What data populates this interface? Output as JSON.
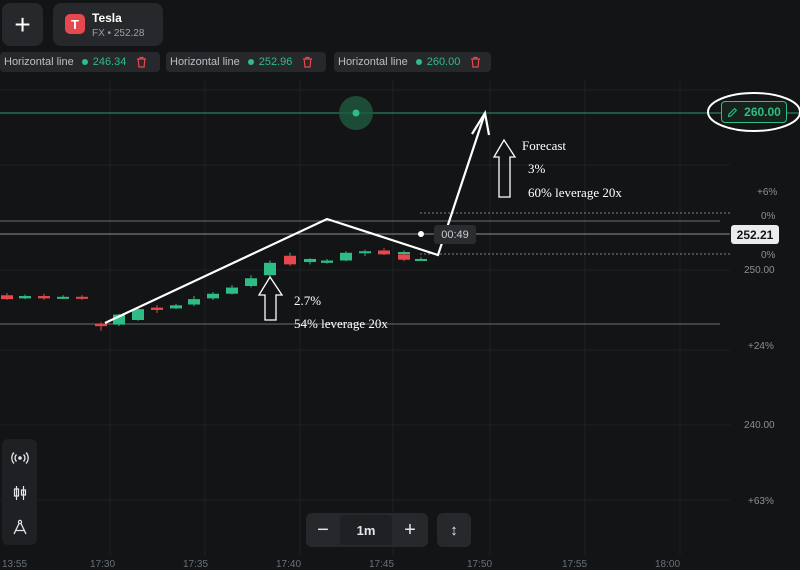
{
  "header": {
    "add_icon": "plus-icon",
    "asset": {
      "name": "Tesla",
      "sub": "FX • 252.28",
      "logo": "T",
      "logo_color": "#e5484d"
    }
  },
  "horizontal_lines": [
    {
      "label": "Horizontal line",
      "value": "246.34"
    },
    {
      "label": "Horizontal line",
      "value": "252.96"
    },
    {
      "label": "Horizontal line",
      "value": "260.00"
    }
  ],
  "price_axis": {
    "tags": [
      {
        "label": "+6%"
      },
      {
        "label": "0%"
      },
      {
        "label": "0%"
      },
      {
        "label": "250.00"
      },
      {
        "label": "+24%"
      },
      {
        "label": "240.00"
      },
      {
        "label": "+63%"
      }
    ],
    "target_line_value": "260.00",
    "current_price": "252.21",
    "timer": "00:49"
  },
  "time_axis": [
    "13:55",
    "17:30",
    "17:35",
    "17:40",
    "17:45",
    "17:50",
    "17:55",
    "18:00"
  ],
  "annotations": {
    "left": {
      "pct": "2.7%",
      "lev": "54% leverage 20x"
    },
    "right": {
      "title": "Forecast",
      "pct": "3%",
      "lev": "60% leverage 20x"
    }
  },
  "controls": {
    "timeframe": "1m",
    "minus": "−",
    "plus": "+",
    "expand": "↕",
    "tools": [
      "broadcast-icon",
      "candles-icon",
      "drawing-compass-icon"
    ]
  },
  "colors": {
    "up": "#2ebd85",
    "down": "#e5484d",
    "background": "#131415"
  },
  "candles": [
    {
      "open": 248.2,
      "close": 247.95,
      "high": 248.35,
      "low": 247.9,
      "dir": "down"
    },
    {
      "open": 248.0,
      "close": 248.15,
      "high": 248.25,
      "low": 247.95,
      "dir": "up"
    },
    {
      "open": 248.15,
      "close": 248.0,
      "high": 248.3,
      "low": 247.9,
      "dir": "down"
    },
    {
      "open": 248.0,
      "close": 248.1,
      "high": 248.2,
      "low": 247.95,
      "dir": "up"
    },
    {
      "open": 248.1,
      "close": 247.98,
      "high": 248.2,
      "low": 247.9,
      "dir": "down"
    },
    {
      "open": 247.98,
      "close": 248.12,
      "high": 248.22,
      "low": 247.9,
      "dir": "up"
    },
    {
      "open": 248.1,
      "close": 248.05,
      "high": 248.2,
      "low": 247.95,
      "dir": "up"
    },
    {
      "open": 246.35,
      "close": 246.2,
      "high": 246.45,
      "low": 245.9,
      "dir": "down"
    },
    {
      "open": 246.3,
      "close": 246.95,
      "high": 247.0,
      "low": 246.2,
      "dir": "up"
    },
    {
      "open": 246.6,
      "close": 247.3,
      "high": 247.45,
      "low": 246.55,
      "dir": "up"
    },
    {
      "open": 247.4,
      "close": 247.25,
      "high": 247.55,
      "low": 247.05,
      "dir": "down"
    },
    {
      "open": 247.35,
      "close": 247.55,
      "high": 247.65,
      "low": 247.3,
      "dir": "up"
    },
    {
      "open": 247.6,
      "close": 247.95,
      "high": 248.15,
      "low": 247.5,
      "dir": "up"
    },
    {
      "open": 248.0,
      "close": 248.3,
      "high": 248.4,
      "low": 247.9,
      "dir": "up"
    },
    {
      "open": 248.3,
      "close": 248.7,
      "high": 248.85,
      "low": 248.25,
      "dir": "up"
    },
    {
      "open": 248.8,
      "close": 249.3,
      "high": 249.5,
      "low": 248.7,
      "dir": "up"
    },
    {
      "open": 249.5,
      "close": 250.3,
      "high": 250.45,
      "low": 249.45,
      "dir": "up"
    },
    {
      "open": 250.6,
      "close": 250.75,
      "high": 250.95,
      "low": 250.5,
      "dir": "up"
    },
    {
      "open": 250.55,
      "close": 250.35,
      "high": 250.6,
      "low": 250.2,
      "dir": "up"
    },
    {
      "open": 250.75,
      "close": 250.2,
      "high": 250.8,
      "low": 250.1,
      "dir": "down"
    },
    {
      "open": 250.3,
      "close": 250.45,
      "high": 250.55,
      "low": 250.25,
      "dir": "up"
    },
    {
      "open": 250.45,
      "close": 250.95,
      "high": 251.05,
      "low": 250.4,
      "dir": "up"
    },
    {
      "open": 251.0,
      "close": 251.05,
      "high": 251.15,
      "low": 250.75,
      "dir": "up"
    },
    {
      "open": 251.1,
      "close": 250.85,
      "high": 251.25,
      "low": 250.8,
      "dir": "down"
    },
    {
      "open": 250.95,
      "close": 251.0,
      "high": 251.1,
      "low": 250.8,
      "dir": "up"
    },
    {
      "open": 250.85,
      "close": 250.5,
      "high": 250.9,
      "low": 250.4,
      "dir": "down"
    },
    {
      "open": 250.55,
      "close": 250.55,
      "high": 250.65,
      "low": 250.45,
      "dir": "up"
    }
  ]
}
